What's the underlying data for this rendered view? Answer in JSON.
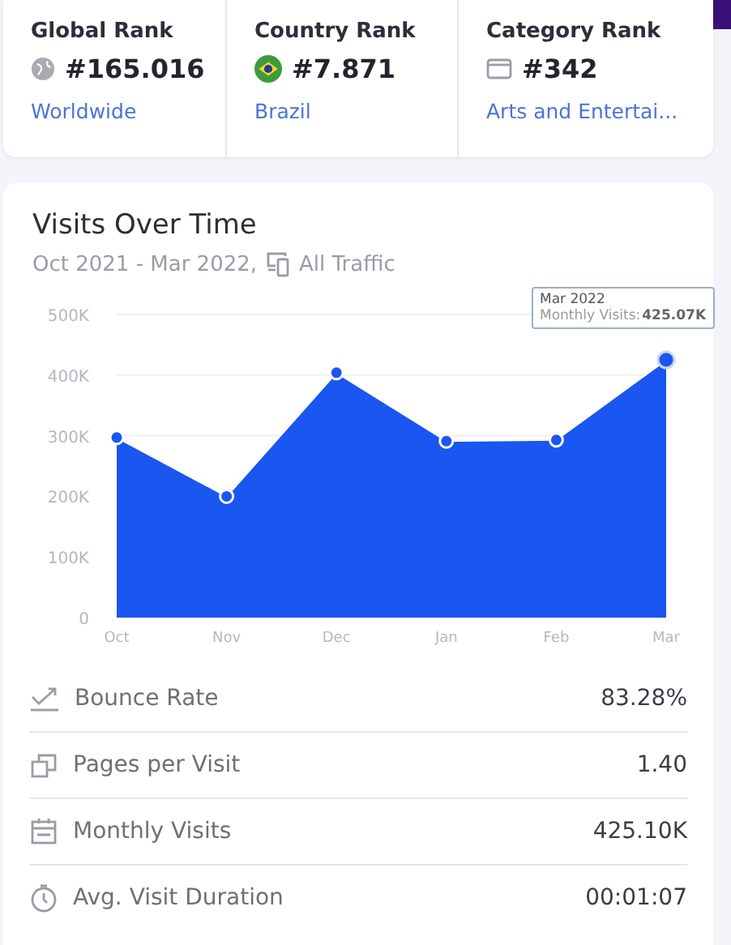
{
  "ranks": [
    {
      "title": "Global Rank",
      "value": "#165.016",
      "link": "Worldwide"
    },
    {
      "title": "Country Rank",
      "value": "#7.871",
      "link": "Brazil"
    },
    {
      "title": "Category Rank",
      "value": "#342",
      "link": "Arts and Entertai..."
    }
  ],
  "visits": {
    "title": "Visits Over Time",
    "period": "Oct 2021 - Mar 2022,",
    "traffic": "All Traffic",
    "tooltip": {
      "title": "Mar 2022",
      "label": "Monthly Visits:",
      "value": "425.07K"
    },
    "chart_data": {
      "type": "area",
      "categories": [
        "Oct",
        "Nov",
        "Dec",
        "Jan",
        "Feb",
        "Mar"
      ],
      "series": [
        {
          "color": "#1a56f0",
          "values": [
            297000,
            200000,
            404000,
            291000,
            293000,
            425000
          ]
        }
      ],
      "ylim": [
        0,
        500000
      ],
      "yticks": [
        {
          "value": 0,
          "label": "0"
        },
        {
          "value": 100000,
          "label": "100K"
        },
        {
          "value": 200000,
          "label": "200K"
        },
        {
          "value": 300000,
          "label": "300K"
        },
        {
          "value": 400000,
          "label": "400K"
        },
        {
          "value": 500000,
          "label": "500K"
        }
      ]
    }
  },
  "metrics": [
    {
      "label": "Bounce Rate",
      "value": "83.28%"
    },
    {
      "label": "Pages per Visit",
      "value": "1.40"
    },
    {
      "label": "Monthly Visits",
      "value": "425.10K"
    },
    {
      "label": "Avg. Visit Duration",
      "value": "00:01:07"
    }
  ]
}
